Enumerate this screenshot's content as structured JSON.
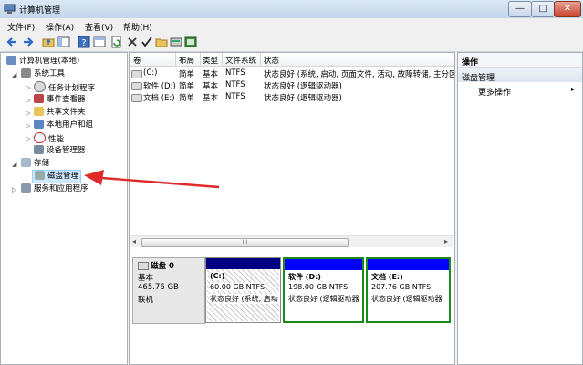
{
  "window": {
    "title": "计算机管理",
    "min_glyph": "—",
    "max_glyph": "□",
    "close_glyph": "✕"
  },
  "menu": [
    "文件(F)",
    "操作(A)",
    "查看(V)",
    "帮助(H)"
  ],
  "tree": {
    "root": "计算机管理(本地)",
    "system_tools": "系统工具",
    "task_scheduler": "任务计划程序",
    "event_viewer": "事件查看器",
    "shared_folders": "共享文件夹",
    "local_users": "本地用户和组",
    "performance": "性能",
    "device_manager": "设备管理器",
    "storage": "存储",
    "disk_management": "磁盘管理",
    "services_apps": "服务和应用程序"
  },
  "volume_table": {
    "headers": [
      "卷",
      "布局",
      "类型",
      "文件系统",
      "状态"
    ],
    "rows": [
      [
        "(C:)",
        "简单",
        "基本",
        "NTFS",
        "状态良好 (系统, 启动, 页面文件, 活动, 故障转储, 主分区)"
      ],
      [
        "软件 (D:)",
        "简单",
        "基本",
        "NTFS",
        "状态良好 (逻辑驱动器)"
      ],
      [
        "文档 (E:)",
        "简单",
        "基本",
        "NTFS",
        "状态良好 (逻辑驱动器)"
      ]
    ]
  },
  "scrollbar": {
    "grip": "III",
    "left_arrow": "◂",
    "right_arrow": "▸"
  },
  "disk": {
    "name": "磁盘 0",
    "type": "基本",
    "size": "465.76 GB",
    "status": "联机",
    "partitions": [
      {
        "name": "(C:)",
        "size": "60.00 GB NTFS",
        "status": "状态良好 (系统, 启动",
        "color": "#000080",
        "hatched": true
      },
      {
        "name": "软件  (D:)",
        "size": "198.00 GB NTFS",
        "status": "状态良好 (逻辑驱动器",
        "color": "#0000ff",
        "hatched": false
      },
      {
        "name": "文档  (E:)",
        "size": "207.76 GB NTFS",
        "status": "状态良好 (逻辑驱动器",
        "color": "#0000ff",
        "hatched": false
      }
    ]
  },
  "actions": {
    "header": "操作",
    "section": "磁盘管理",
    "more": "更多操作",
    "more_arrow": "▸"
  },
  "colors": {
    "selection_green": "#1a8a1a",
    "annotation_arrow": "#e02a2a"
  }
}
